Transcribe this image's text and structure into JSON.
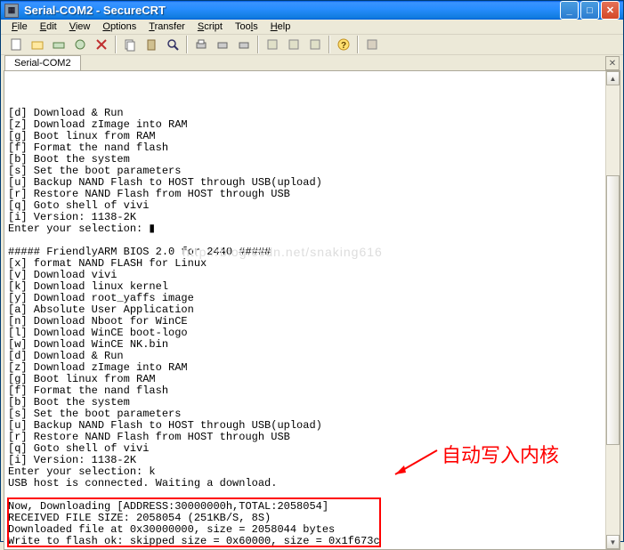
{
  "window": {
    "title": "Serial-COM2 - SecureCRT"
  },
  "menu": {
    "file": "File",
    "edit": "Edit",
    "view": "View",
    "options": "Options",
    "transfer": "Transfer",
    "script": "Script",
    "tools": "Tools",
    "help": "Help"
  },
  "tab": {
    "label": "Serial-COM2"
  },
  "watermark": "http://blog.csdn.net/snaking616",
  "terminal": {
    "lines": [
      "[d] Download & Run",
      "[z] Download zImage into RAM",
      "[g] Boot linux from RAM",
      "[f] Format the nand flash",
      "[b] Boot the system",
      "[s] Set the boot parameters",
      "[u] Backup NAND Flash to HOST through USB(upload)",
      "[r] Restore NAND Flash from HOST through USB",
      "[q] Goto shell of vivi",
      "[i] Version: 1138-2K",
      "Enter your selection: ▮",
      "",
      "##### FriendlyARM BIOS 2.0 for 2440 #####",
      "[x] format NAND FLASH for Linux",
      "[v] Download vivi",
      "[k] Download linux kernel",
      "[y] Download root_yaffs image",
      "[a] Absolute User Application",
      "[n] Download Nboot for WinCE",
      "[l] Download WinCE boot-logo",
      "[w] Download WinCE NK.bin",
      "[d] Download & Run",
      "[z] Download zImage into RAM",
      "[g] Boot linux from RAM",
      "[f] Format the nand flash",
      "[b] Boot the system",
      "[s] Set the boot parameters",
      "[u] Backup NAND Flash to HOST through USB(upload)",
      "[r] Restore NAND Flash from HOST through USB",
      "[q] Goto shell of vivi",
      "[i] Version: 1138-2K",
      "Enter your selection: k",
      "USB host is connected. Waiting a download.",
      "",
      "Now, Downloading [ADDRESS:30000000h,TOTAL:2058054]",
      "RECEIVED FILE SIZE: 2058054 (251KB/S, 8S)",
      "Downloaded file at 0x30000000, size = 2058044 bytes",
      "Write to flash ok: skipped size = 0x60000, size = 0x1f673c"
    ]
  },
  "annotation": {
    "text": "自动写入内核"
  },
  "icons": {
    "new": "📄",
    "open": "📂",
    "save": "💾",
    "saveall": "🗎",
    "disconnect": "✖",
    "copy": "📋",
    "paste": "📄",
    "find": "🔍",
    "print": "🖨",
    "p2": "🖨",
    "p3": "🖨",
    "opt1": "⚙",
    "opt2": "⚙",
    "opt3": "⚙",
    "help": "?",
    "app": "▦"
  }
}
